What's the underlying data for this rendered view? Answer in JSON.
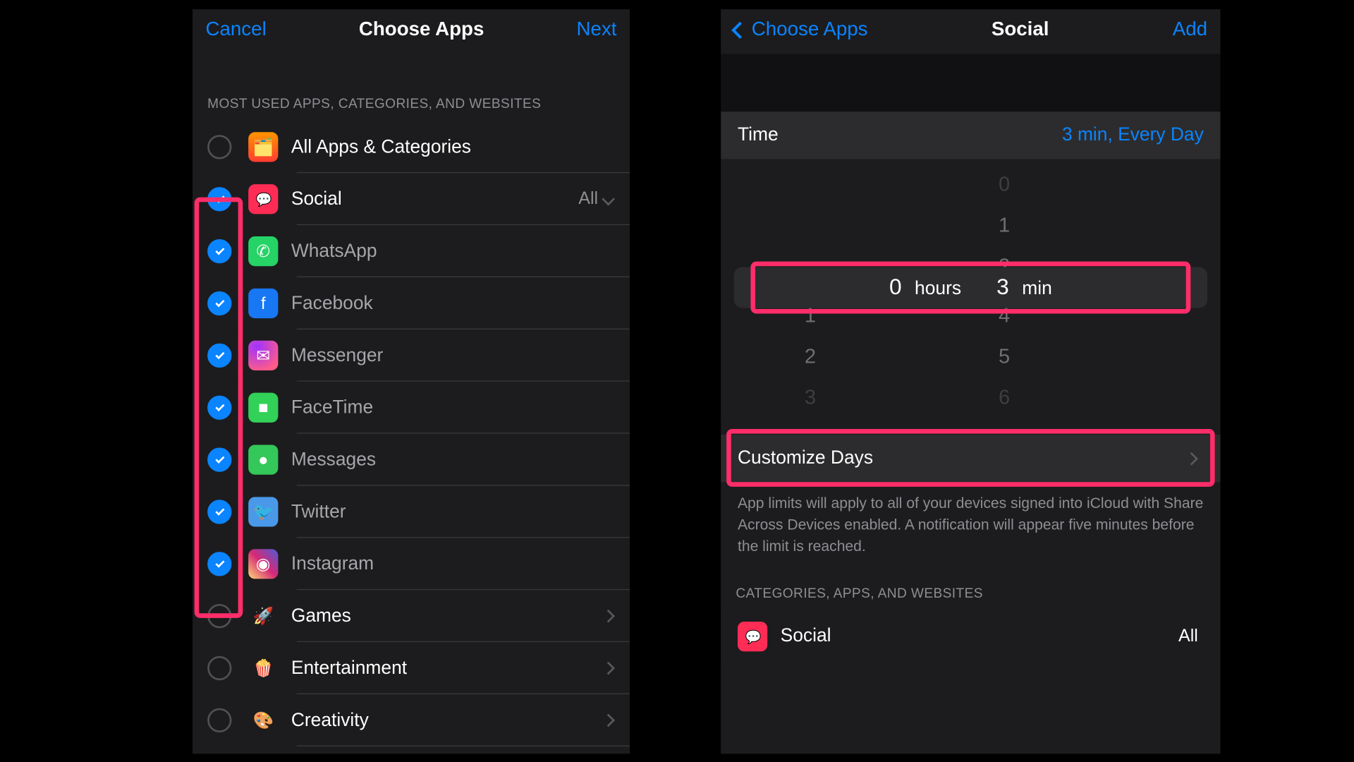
{
  "left": {
    "nav": {
      "cancel": "Cancel",
      "title": "Choose Apps",
      "next": "Next"
    },
    "section_header": "MOST USED APPS, CATEGORIES, AND WEBSITES",
    "rows": [
      {
        "label": "All Apps & Categories",
        "checked": false,
        "icon": "stack-icon",
        "type": "cat",
        "trail": ""
      },
      {
        "label": "Social",
        "checked": true,
        "icon": "social-icon",
        "type": "cat",
        "trail": "All",
        "expand": true
      },
      {
        "label": "WhatsApp",
        "checked": true,
        "icon": "whatsapp-icon",
        "type": "app"
      },
      {
        "label": "Facebook",
        "checked": true,
        "icon": "facebook-icon",
        "type": "app"
      },
      {
        "label": "Messenger",
        "checked": true,
        "icon": "messenger-icon",
        "type": "app"
      },
      {
        "label": "FaceTime",
        "checked": true,
        "icon": "facetime-icon",
        "type": "app"
      },
      {
        "label": "Messages",
        "checked": true,
        "icon": "messages-icon",
        "type": "app"
      },
      {
        "label": "Twitter",
        "checked": true,
        "icon": "twitter-icon",
        "type": "app"
      },
      {
        "label": "Instagram",
        "checked": true,
        "icon": "instagram-icon",
        "type": "app"
      },
      {
        "label": "Games",
        "checked": false,
        "icon": "games-icon",
        "type": "cat",
        "chevron": true
      },
      {
        "label": "Entertainment",
        "checked": false,
        "icon": "entertainment-icon",
        "type": "cat",
        "chevron": true
      },
      {
        "label": "Creativity",
        "checked": false,
        "icon": "creativity-icon",
        "type": "cat",
        "chevron": true
      }
    ]
  },
  "right": {
    "nav": {
      "back": "Choose Apps",
      "title": "Social",
      "action": "Add"
    },
    "time_row": {
      "label": "Time",
      "value": "3 min, Every Day"
    },
    "picker": {
      "hours_above": [
        "",
        ""
      ],
      "hours_sel": "0",
      "hours_unit": "hours",
      "hours_below": [
        "1",
        "2",
        "3"
      ],
      "min_above": [
        "0",
        "1",
        "2"
      ],
      "min_sel": "3",
      "min_unit": "min",
      "min_below": [
        "4",
        "5",
        "6"
      ]
    },
    "customize": "Customize Days",
    "footer": "App limits will apply to all of your devices signed into iCloud with Share Across Devices enabled. A notification will appear five minutes before the limit is reached.",
    "section2": "CATEGORIES, APPS, AND WEBSITES",
    "cat_row": {
      "label": "Social",
      "trail": "All"
    }
  },
  "icon_glyphs": {
    "stack-icon": "🗂️",
    "social-icon": "",
    "whatsapp-icon": "✆",
    "facebook-icon": "f",
    "messenger-icon": "✉",
    "facetime-icon": "■",
    "messages-icon": "●",
    "twitter-icon": "🐦",
    "instagram-icon": "◉",
    "games-icon": "🚀",
    "entertainment-icon": "🍿",
    "creativity-icon": "🎨"
  }
}
